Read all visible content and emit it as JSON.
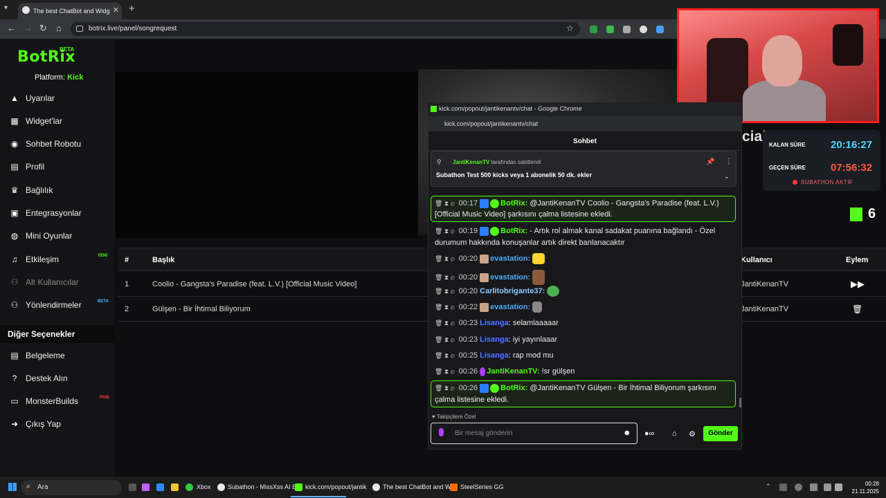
{
  "browser": {
    "tab_title": "The best ChatBot and Widg",
    "url": "botrix.live/panel/songrequest"
  },
  "sidebar": {
    "logo": "BotRix",
    "logo_badge": "BETA",
    "platform_label": "Platform:",
    "platform_value": "Kick",
    "items": [
      {
        "label": "Uyarılar",
        "icon": "warning-icon"
      },
      {
        "label": "Widget'lar",
        "icon": "widgets-icon"
      },
      {
        "label": "Sohbet Robotu",
        "icon": "robot-icon"
      },
      {
        "label": "Profil",
        "icon": "profile-icon"
      },
      {
        "label": "Bağlılık",
        "icon": "trophy-icon"
      },
      {
        "label": "Entegrasyonlar",
        "icon": "integrations-icon"
      },
      {
        "label": "Mini Oyunlar",
        "icon": "gamepad-icon"
      },
      {
        "label": "Etkileşim",
        "icon": "music-icon",
        "badge": "YENİ"
      },
      {
        "label": "Alt Kullanıcılar",
        "icon": "subusers-icon"
      },
      {
        "label": "Yönlendirmeler",
        "icon": "redirect-icon",
        "badge": "BETA"
      }
    ],
    "section_title": "Diğer Seçenekler",
    "other_items": [
      {
        "label": "Belgeleme",
        "icon": "docs-icon"
      },
      {
        "label": "Destek Alın",
        "icon": "help-icon"
      },
      {
        "label": "MonsterBuilds",
        "icon": "laptop-icon",
        "badge": "PAID"
      },
      {
        "label": "Çıkış Yap",
        "icon": "logout-icon"
      }
    ]
  },
  "table": {
    "headers": {
      "num": "#",
      "title": "Başlık",
      "user": "Kullanıcı",
      "action": "Eylem"
    },
    "rows": [
      {
        "num": "1",
        "title": "Coolio - Gangsta's Paradise (feat. L.V.) [Official Music Video]",
        "user": "JantiKenanTV"
      },
      {
        "num": "2",
        "title": "Gülşen - Bir İhtimal Biliyorum",
        "user": "JantiKenanTV"
      }
    ]
  },
  "overlay": {
    "song_title_partial": "cial Music Video]",
    "remaining_label": "KALAN SÜRE",
    "remaining_value": "20:16:27",
    "elapsed_label": "GEÇEN SÜRE",
    "elapsed_value": "07:56:32",
    "status": "SUBATHON AKTİF",
    "kick_count": "6"
  },
  "chat": {
    "window_title": "kick.com/popout/jantikenantv/chat - Google Chrome",
    "url": "kick.com/popout/jantikenantv/chat",
    "header": "Sohbet",
    "pinned_by_user": "JantiKenanTV",
    "pinned_by_suffix": "tarafından sabitlendi",
    "pinned_text": "Subathon Test 500 kicks veya 1 abonelik 50 dk. ekler",
    "messages": [
      {
        "time": "00:17",
        "user": "BotRix:",
        "text": "@JantiKenanTV Coolio - Gangsta's Paradise (feat. L.V.)",
        "text2": "[Official Music Video] şarkısını çalma listesine ekledi."
      },
      {
        "time": "00:19",
        "user": "BotRix:",
        "text": "- Artık rol almak kanal sadakat puanına bağlandı - Özel",
        "text2": "durumum hakkında konuşanlar artık direkt banlanacaktır"
      },
      {
        "time": "00:20",
        "user": "evastation:",
        "text": ""
      },
      {
        "time": "00:20",
        "user": "evastation:",
        "text": ""
      },
      {
        "time": "00:20",
        "user": "Carlitobrigante37:",
        "text": ""
      },
      {
        "time": "00:22",
        "user": "evastation:",
        "text": ""
      },
      {
        "time": "00:23",
        "user": "Lisanga",
        "text": ": selamlaaaaar"
      },
      {
        "time": "00:23",
        "user": "Lisanga",
        "text": ": iyi yayınlaaar"
      },
      {
        "time": "00:25",
        "user": "Lisanga",
        "text": ": rap mod mu"
      },
      {
        "time": "00:26",
        "user": "JantiKenanTV:",
        "text": "!sr gülşen"
      },
      {
        "time": "00:26",
        "user": "BotRix:",
        "text": "@JantiKenanTV Gülşen - Bir İhtimal Biliyorum şarkısını",
        "text2": "çalma listesine ekledi."
      }
    ],
    "followers_label": "Takipçilere Özel",
    "input_placeholder": "Bir mesaj gönderin",
    "send_label": "Gönder"
  },
  "taskbar": {
    "search": "Ara",
    "apps": [
      "Xbox",
      "Subathon - MissXss AI E",
      "kick.com/popout/jantik",
      "The best ChatBot and W",
      "SteelSeries GG"
    ],
    "time": "00:28",
    "date": "21.11.2025"
  },
  "colors": {
    "accent": "#53fc18",
    "webcam_border": "#ff1e1e",
    "remaining": "#4fd8ff",
    "elapsed": "#ff5a3c"
  }
}
